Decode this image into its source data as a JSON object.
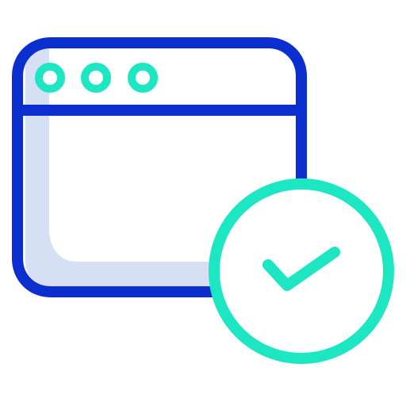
{
  "icon": {
    "name": "browser-window-check-icon",
    "parts": [
      "browser-window-icon",
      "window-dot-icon",
      "check-circle-icon",
      "check-mark-icon"
    ],
    "dots_count": 3
  },
  "colors": {
    "window_stroke": "#0b2fcf",
    "window_fill_shadow": "#d6e0f4",
    "accent": "#1de6c2",
    "background": "#ffffff"
  }
}
